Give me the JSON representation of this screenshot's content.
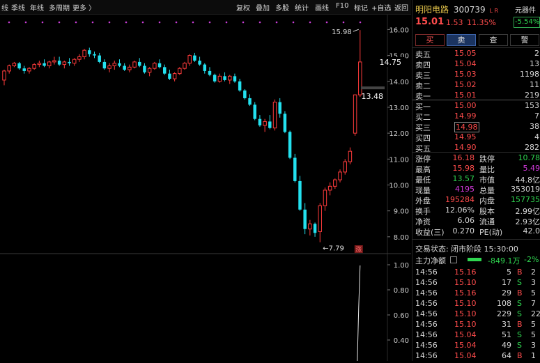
{
  "toolbar": {
    "left_items": [
      "线",
      "季线",
      "年线",
      "多周期",
      "更多 〉"
    ],
    "right_items": [
      "复权",
      "叠加",
      "多股",
      "统计",
      "画线",
      "F10",
      "标记",
      "+自选",
      "返回"
    ]
  },
  "chart_data": {
    "type": "candlestick",
    "price_axis": {
      "min": 7.7,
      "max": 16.2,
      "ticks": [
        16.0,
        15.0,
        14.0,
        13.0,
        12.0,
        11.0,
        10.0,
        9.0,
        8.0
      ]
    },
    "price_labels": {
      "current": "14.75",
      "prev_close": "13.48",
      "high_annot": "15.98",
      "low_annot": "7.79"
    },
    "volume_axis": {
      "ticks": [
        "1.00",
        "0.80",
        "0.60",
        "0.40"
      ]
    },
    "limit_up_marker": "涨",
    "candles": [
      [
        14.05,
        14.45,
        13.85,
        14.4
      ],
      [
        14.4,
        14.65,
        14.3,
        14.6
      ],
      [
        14.6,
        14.75,
        14.55,
        14.7
      ],
      [
        14.7,
        14.75,
        14.45,
        14.5
      ],
      [
        14.5,
        14.6,
        14.3,
        14.4
      ],
      [
        14.4,
        14.55,
        14.3,
        14.5
      ],
      [
        14.5,
        14.7,
        14.45,
        14.65
      ],
      [
        14.65,
        14.8,
        14.55,
        14.7
      ],
      [
        14.7,
        14.85,
        14.55,
        14.6
      ],
      [
        14.6,
        14.8,
        14.5,
        14.75
      ],
      [
        14.75,
        14.95,
        14.65,
        14.8
      ],
      [
        14.8,
        14.95,
        14.6,
        14.65
      ],
      [
        14.65,
        14.8,
        14.5,
        14.75
      ],
      [
        14.75,
        14.9,
        14.6,
        14.7
      ],
      [
        14.7,
        14.9,
        14.6,
        14.85
      ],
      [
        14.85,
        15.05,
        14.75,
        14.95
      ],
      [
        14.95,
        15.25,
        14.85,
        15.2
      ],
      [
        15.2,
        15.3,
        14.95,
        15.05
      ],
      [
        15.05,
        15.15,
        14.9,
        15.0
      ],
      [
        15.0,
        15.1,
        14.7,
        14.75
      ],
      [
        14.75,
        14.85,
        14.45,
        14.5
      ],
      [
        14.5,
        14.7,
        14.35,
        14.6
      ],
      [
        14.6,
        14.8,
        14.45,
        14.7
      ],
      [
        14.7,
        14.85,
        14.55,
        14.6
      ],
      [
        14.6,
        14.7,
        14.4,
        14.45
      ],
      [
        14.45,
        14.65,
        14.35,
        14.55
      ],
      [
        14.55,
        14.8,
        14.5,
        14.75
      ],
      [
        14.75,
        14.9,
        14.55,
        14.6
      ],
      [
        14.6,
        14.7,
        14.3,
        14.35
      ],
      [
        14.35,
        14.55,
        14.2,
        14.5
      ],
      [
        14.5,
        14.75,
        14.45,
        14.7
      ],
      [
        14.7,
        14.85,
        14.5,
        14.55
      ],
      [
        14.55,
        14.65,
        14.25,
        14.3
      ],
      [
        14.3,
        14.45,
        14.05,
        14.1
      ],
      [
        14.1,
        14.35,
        14.0,
        14.3
      ],
      [
        14.3,
        14.55,
        14.25,
        14.5
      ],
      [
        14.5,
        14.75,
        14.45,
        14.7
      ],
      [
        14.7,
        15.05,
        14.6,
        15.0
      ],
      [
        15.0,
        15.1,
        14.75,
        14.8
      ],
      [
        14.8,
        14.95,
        14.6,
        14.65
      ],
      [
        14.65,
        14.7,
        14.3,
        14.4
      ],
      [
        14.4,
        14.55,
        14.2,
        14.25
      ],
      [
        14.25,
        14.3,
        13.95,
        14.0
      ],
      [
        14.0,
        14.3,
        13.95,
        14.2
      ],
      [
        14.2,
        14.35,
        14.0,
        14.05
      ],
      [
        14.05,
        14.25,
        13.9,
        14.2
      ],
      [
        14.2,
        14.3,
        13.95,
        14.0
      ],
      [
        14.0,
        14.1,
        13.6,
        13.65
      ],
      [
        13.65,
        13.7,
        13.3,
        13.35
      ],
      [
        13.35,
        13.5,
        13.05,
        13.1
      ],
      [
        13.1,
        13.2,
        12.5,
        12.55
      ],
      [
        12.55,
        12.7,
        12.25,
        12.3
      ],
      [
        12.3,
        12.55,
        12.05,
        12.45
      ],
      [
        12.45,
        12.7,
        12.15,
        12.2
      ],
      [
        12.2,
        13.3,
        12.1,
        13.2
      ],
      [
        13.2,
        13.35,
        12.6,
        12.75
      ],
      [
        12.75,
        12.85,
        12.0,
        12.05
      ],
      [
        12.05,
        12.1,
        11.0,
        11.05
      ],
      [
        11.05,
        11.2,
        10.1,
        10.15
      ],
      [
        10.15,
        10.35,
        9.0,
        9.05
      ],
      [
        9.05,
        9.3,
        8.1,
        8.3
      ],
      [
        8.3,
        8.65,
        8.05,
        8.5
      ],
      [
        8.5,
        8.55,
        8.0,
        8.15
      ],
      [
        8.2,
        9.3,
        7.79,
        9.2
      ],
      [
        9.2,
        9.9,
        9.0,
        9.8
      ],
      [
        9.8,
        10.1,
        9.6,
        9.95
      ],
      [
        9.95,
        10.25,
        9.85,
        10.2
      ],
      [
        10.2,
        10.6,
        10.1,
        10.5
      ],
      [
        10.5,
        11.0,
        10.4,
        10.9
      ],
      [
        10.9,
        11.45,
        10.8,
        11.3
      ],
      [
        12.0,
        13.5,
        11.9,
        13.48
      ],
      [
        13.48,
        15.98,
        13.4,
        14.75
      ]
    ]
  },
  "stock": {
    "name": "明阳电路",
    "code": "300739",
    "tags": "L R",
    "price": "15.01",
    "change": "1.53",
    "pct": "11.35%",
    "sector_label": "元器件",
    "sector_pct": "-5.54%"
  },
  "actions": {
    "buy": "买",
    "sell": "卖",
    "check": "查",
    "alert": "警"
  },
  "order_book": {
    "asks": [
      {
        "label": "卖五",
        "price": "15.05",
        "vol": "2"
      },
      {
        "label": "卖四",
        "price": "15.04",
        "vol": "13"
      },
      {
        "label": "卖三",
        "price": "15.03",
        "vol": "1198"
      },
      {
        "label": "卖二",
        "price": "15.02",
        "vol": "11"
      },
      {
        "label": "卖一",
        "price": "15.01",
        "vol": "219"
      }
    ],
    "bids": [
      {
        "label": "买一",
        "price": "15.00",
        "vol": "153"
      },
      {
        "label": "买二",
        "price": "14.99",
        "vol": "7"
      },
      {
        "label": "买三",
        "price": "14.98",
        "vol": "38"
      },
      {
        "label": "买四",
        "price": "14.95",
        "vol": "4"
      },
      {
        "label": "买五",
        "price": "14.90",
        "vol": "282"
      }
    ]
  },
  "stats": [
    [
      "涨停",
      "16.18",
      "跌停",
      "10.78"
    ],
    [
      "最高",
      "15.98",
      "量比",
      "5.49"
    ],
    [
      "最低",
      "13.57",
      "市值",
      "44.8亿"
    ],
    [
      "现量",
      "4195",
      "总量",
      "353019"
    ],
    [
      "外盘",
      "195284",
      "内盘",
      "157735"
    ],
    [
      "换手",
      "12.06%",
      "股本",
      "2.99亿"
    ],
    [
      "净资",
      "6.06",
      "流通",
      "2.93亿"
    ],
    [
      "收益(三)",
      "0.270",
      "PE(动)",
      "42.0"
    ]
  ],
  "status": {
    "label": "交易状态:",
    "value": "闭市阶段 15:30:00"
  },
  "capital": {
    "label": "主力净额",
    "value": "-849.1万",
    "pct": "-2%"
  },
  "ticks": [
    {
      "time": "14:56",
      "price": "15.16",
      "vol": "5",
      "side": "B",
      "n": "2"
    },
    {
      "time": "14:56",
      "price": "15.10",
      "vol": "17",
      "side": "S",
      "n": "3"
    },
    {
      "time": "14:56",
      "price": "15.16",
      "vol": "29",
      "side": "B",
      "n": "5"
    },
    {
      "time": "14:56",
      "price": "15.10",
      "vol": "108",
      "side": "S",
      "n": "7"
    },
    {
      "time": "14:56",
      "price": "15.10",
      "vol": "229",
      "side": "S",
      "n": "22"
    },
    {
      "time": "14:56",
      "price": "15.10",
      "vol": "31",
      "side": "B",
      "n": "5"
    },
    {
      "time": "14:56",
      "price": "15.04",
      "vol": "51",
      "side": "S",
      "n": "5"
    },
    {
      "time": "14:56",
      "price": "15.04",
      "vol": "49",
      "side": "S",
      "n": "3"
    },
    {
      "time": "14:56",
      "price": "15.04",
      "vol": "64",
      "side": "B",
      "n": "1"
    }
  ],
  "colors": {
    "up": "#ff3b3b",
    "down": "#23e1ef",
    "bg": "#000000",
    "grid": "#2a2a2a"
  }
}
